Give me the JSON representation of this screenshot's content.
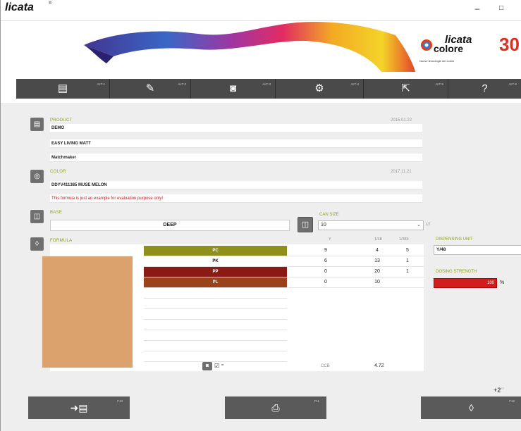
{
  "titlebar": {
    "app_name": "licata",
    "reg": "®",
    "minimize": "–",
    "maximize": "□"
  },
  "banner": {
    "logo_licata": "licata",
    "logo_colore": "colore",
    "logo_tagline": "Nuove tecnologie del colore",
    "anniversary": "30"
  },
  "toolbar": {
    "items": [
      {
        "icon": "book-icon",
        "glyph": "▤",
        "key": "ALT-1"
      },
      {
        "icon": "pencil-icon",
        "glyph": "✎",
        "key": "ALT-2"
      },
      {
        "icon": "monitor-icon",
        "glyph": "◙",
        "key": "ALT-3"
      },
      {
        "icon": "gear-icon",
        "glyph": "⚙",
        "key": "ALT-4"
      },
      {
        "icon": "export-icon",
        "glyph": "⇱",
        "key": "ALT-5"
      },
      {
        "icon": "help-icon",
        "glyph": "?",
        "key": "ALT-6"
      }
    ]
  },
  "product": {
    "label": "PRODUCT",
    "date": "2015.01.22",
    "code": "DEMO",
    "name": "EASY LIVING MATT",
    "system": "Matchmaker"
  },
  "color": {
    "label": "COLOR",
    "date": "2017.11.21",
    "name": "DDYV411385 MUSE MELON",
    "warning": "This formula is just an example for evaluation purpose only!"
  },
  "base": {
    "label": "BASE",
    "value": "DEEP"
  },
  "can": {
    "label": "CAN SIZE",
    "value": "10",
    "unit": "LT"
  },
  "formula": {
    "label": "FORMULA",
    "columns": {
      "y": "Y",
      "y48": "1/48",
      "y384": "1/384"
    },
    "colorants": [
      {
        "name": "PC",
        "color": "#8f8f1c",
        "text": "#ffffff",
        "y": "9",
        "y48": "4",
        "y384": "5"
      },
      {
        "name": "PK",
        "color": "#ffffff",
        "text": "#111111",
        "y": "6",
        "y48": "13",
        "y384": "1"
      },
      {
        "name": "PP",
        "color": "#8b1a14",
        "text": "#ffffff",
        "y": "0",
        "y48": "20",
        "y384": "1"
      },
      {
        "name": "PL",
        "color": "#9a4219",
        "text": "#ffffff",
        "y": "0",
        "y48": "10",
        "y384": ""
      }
    ],
    "swatch_color": "#dca26e",
    "footer_unit": "CCB",
    "footer_total": "4.72"
  },
  "dispensing": {
    "label": "DISPENSING UNIT",
    "value": "Y/48"
  },
  "strength": {
    "label": "DOSING STRENGTH",
    "value": "100",
    "unit": "%"
  },
  "bottom": {
    "plus": "+2",
    "buttons": [
      {
        "icon": "add-to-book-icon",
        "glyph": "➜▤",
        "key": "F10"
      },
      {
        "icon": "print-icon",
        "glyph": "⎙",
        "key": "F11"
      },
      {
        "icon": "dispense-icon",
        "glyph": "◊",
        "key": "F12"
      }
    ]
  }
}
